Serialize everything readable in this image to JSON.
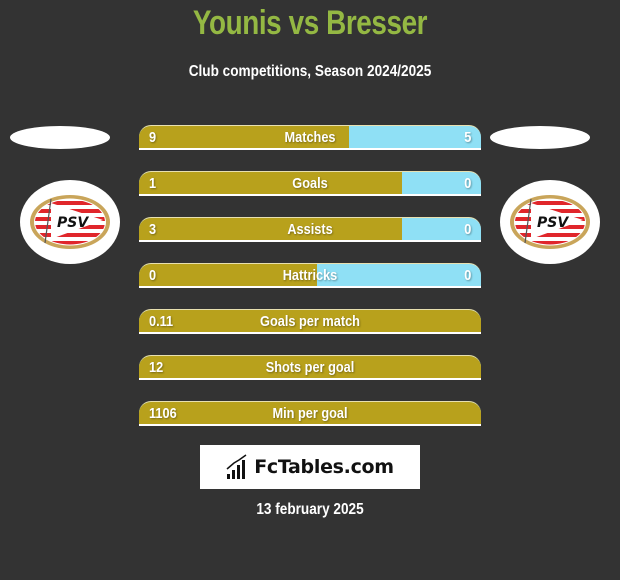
{
  "header": {
    "title": "Younis vs Bresser",
    "subtitle": "Club competitions, Season 2024/2025"
  },
  "players": {
    "left": {
      "club": "PSV",
      "badge_icon": "psv-club-badge"
    },
    "right": {
      "club": "PSV",
      "badge_icon": "psv-club-badge"
    }
  },
  "colors": {
    "left_bar": "#b8a11c",
    "right_bar": "#8fe0f5",
    "title": "#94b843",
    "background": "#333333"
  },
  "stats": [
    {
      "label": "Matches",
      "left": "9",
      "right": "5",
      "left_share": 0.615
    },
    {
      "label": "Goals",
      "left": "1",
      "right": "0",
      "left_share": 0.77
    },
    {
      "label": "Assists",
      "left": "3",
      "right": "0",
      "left_share": 0.77
    },
    {
      "label": "Hattricks",
      "left": "0",
      "right": "0",
      "left_share": 0.52
    },
    {
      "label": "Goals per match",
      "left": "0.11",
      "right": "",
      "left_share": 1.0
    },
    {
      "label": "Shots per goal",
      "left": "12",
      "right": "",
      "left_share": 1.0
    },
    {
      "label": "Min per goal",
      "left": "1106",
      "right": "",
      "left_share": 1.0
    }
  ],
  "footer": {
    "brand": "FcTables.com",
    "date": "13 february 2025"
  }
}
